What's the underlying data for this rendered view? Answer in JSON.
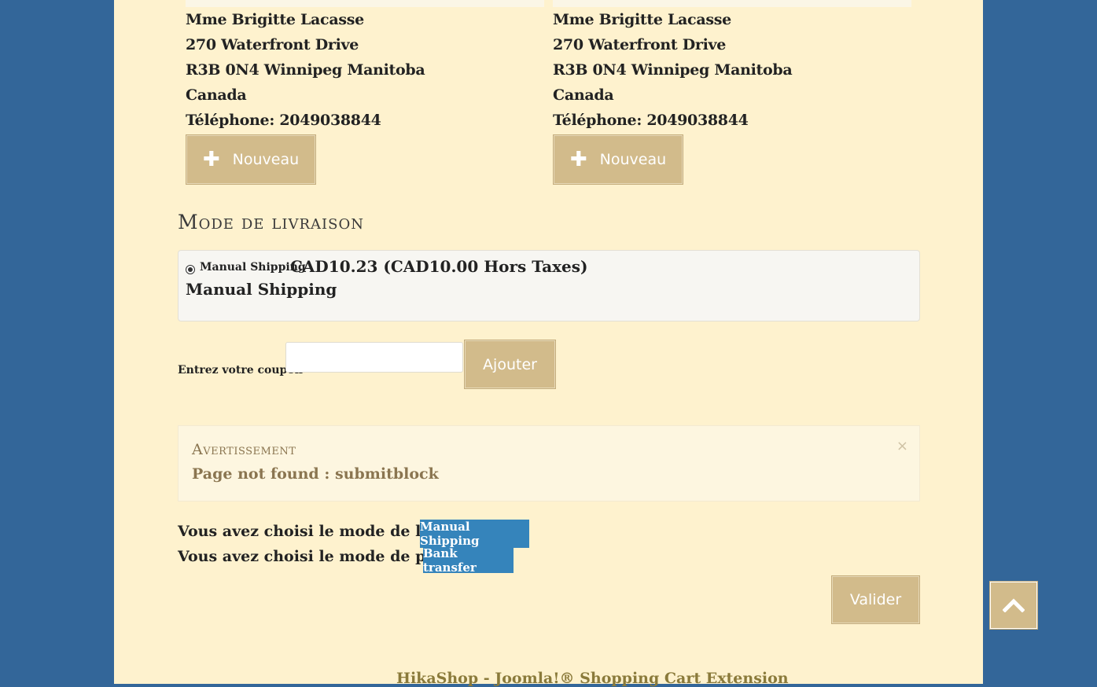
{
  "addresses": {
    "billing": {
      "lines": [
        "Mme Brigitte Lacasse",
        "270 Waterfront Drive",
        "R3B 0N4 Winnipeg Manitoba",
        "Canada",
        "Téléphone: 2049038844"
      ],
      "new_button": "Nouveau"
    },
    "shipping": {
      "lines": [
        "Mme Brigitte Lacasse",
        "270 Waterfront Drive",
        "R3B 0N4 Winnipeg Manitoba",
        "Canada",
        "Téléphone: 2049038844"
      ],
      "new_button": "Nouveau"
    }
  },
  "shipping_method": {
    "title": "Mode de livraison",
    "option_name": "Manual Shipping",
    "option_price": "CAD10.23 (CAD10.00 Hors Taxes)",
    "option_description": "Manual Shipping",
    "selected": true
  },
  "coupon": {
    "label": "Entrez votre coupon",
    "value": "",
    "button": "Ajouter"
  },
  "alert": {
    "title": "Avertissement",
    "message": "Page not found : submitblock",
    "close": "×"
  },
  "summary": {
    "shipping_text": "Vous avez choisi le mode de livraison:",
    "shipping_value": "Manual Shipping",
    "payment_text": "Vous avez choisi le mode de paiement:",
    "payment_value": "Bank transfer"
  },
  "validate_button": "Valider",
  "footer_link": "HikaShop - Joomla!® Shopping Cart Extension",
  "colors": {
    "page_bg": "#336699",
    "content_bg": "#fef2ce",
    "button_gold": "#d2bb8b",
    "badge_blue": "#3584bb"
  }
}
